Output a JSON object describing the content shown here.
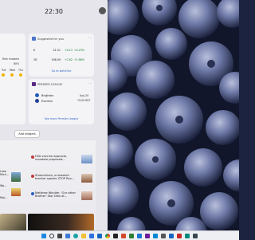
{
  "clock": {
    "time": "22:30"
  },
  "profile": {
    "initial": ""
  },
  "weather": {
    "condition": "Rain showers",
    "humidity": "80%",
    "days": [
      "Tue",
      "Wed",
      "Thu"
    ]
  },
  "stocks": {
    "header": "Suggested for you",
    "rows": [
      {
        "symbol": "K",
        "value": "51.51",
        "change": "+0.13",
        "percent": "+0.25%"
      },
      {
        "symbol": "GE",
        "value": "106.09",
        "change": "+2.82",
        "percent": "+2.86%"
      }
    ],
    "link": "Go to watchlist"
  },
  "league": {
    "header": "PREMIER LEAGUE",
    "team_home": "Brighton",
    "team_away": "Everton",
    "date": "Aug 20",
    "time": "15:00 BST",
    "link": "See more Premier League"
  },
  "add_widgets": {
    "label": "Add widgets"
  },
  "left_news": [
    {
      "label": "Lake Mich..."
    },
    {
      "label": "Wo..."
    },
    {
      "label": "Mai..."
    }
  ],
  "news": [
    {
      "title": "FDA vaccine approval, mandate proposals...",
      "accent": "#c23b3b"
    },
    {
      "title": "Streamlined, unmasked teacher speaks STOP Rev...",
      "accent": "#c23b3b"
    },
    {
      "title": "Matthew Windler, 'Our other Brother' Star Dies at...",
      "accent": "#2b5fb9"
    }
  ],
  "colors": {
    "panel": "#e6e5ec",
    "link": "#2f62c6",
    "positive": "#0f7b28",
    "taskbar": "#eeeff3",
    "wallpaper": "#1c2340"
  },
  "taskbar": {
    "icons": [
      "windows-icon",
      "search-icon",
      "task-view-icon",
      "widgets-icon",
      "edge-icon",
      "explorer-icon",
      "store-icon",
      "mail-icon",
      "chrome-icon",
      "terminal-icon",
      "app-icon",
      "app-icon",
      "app-icon",
      "app-icon",
      "app-icon",
      "app-icon",
      "app-icon",
      "app-icon",
      "app-icon",
      "app-icon"
    ]
  }
}
